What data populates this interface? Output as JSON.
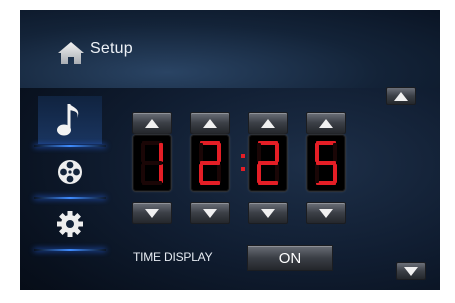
{
  "header": {
    "title": "Setup",
    "home_icon": "home-icon"
  },
  "sidebar": {
    "items": [
      {
        "icon": "music-note-icon",
        "active": true
      },
      {
        "icon": "film-reel-icon",
        "active": false
      },
      {
        "icon": "gear-icon",
        "active": false
      }
    ]
  },
  "clock": {
    "digits": [
      "1",
      "2",
      "2",
      "5"
    ],
    "separator": ":",
    "digit_color": "#e41e26"
  },
  "time_display": {
    "label": "TIME DISPLAY",
    "value": "ON"
  },
  "colors": {
    "accent": "#3f8cff",
    "background": "#0c1829"
  }
}
